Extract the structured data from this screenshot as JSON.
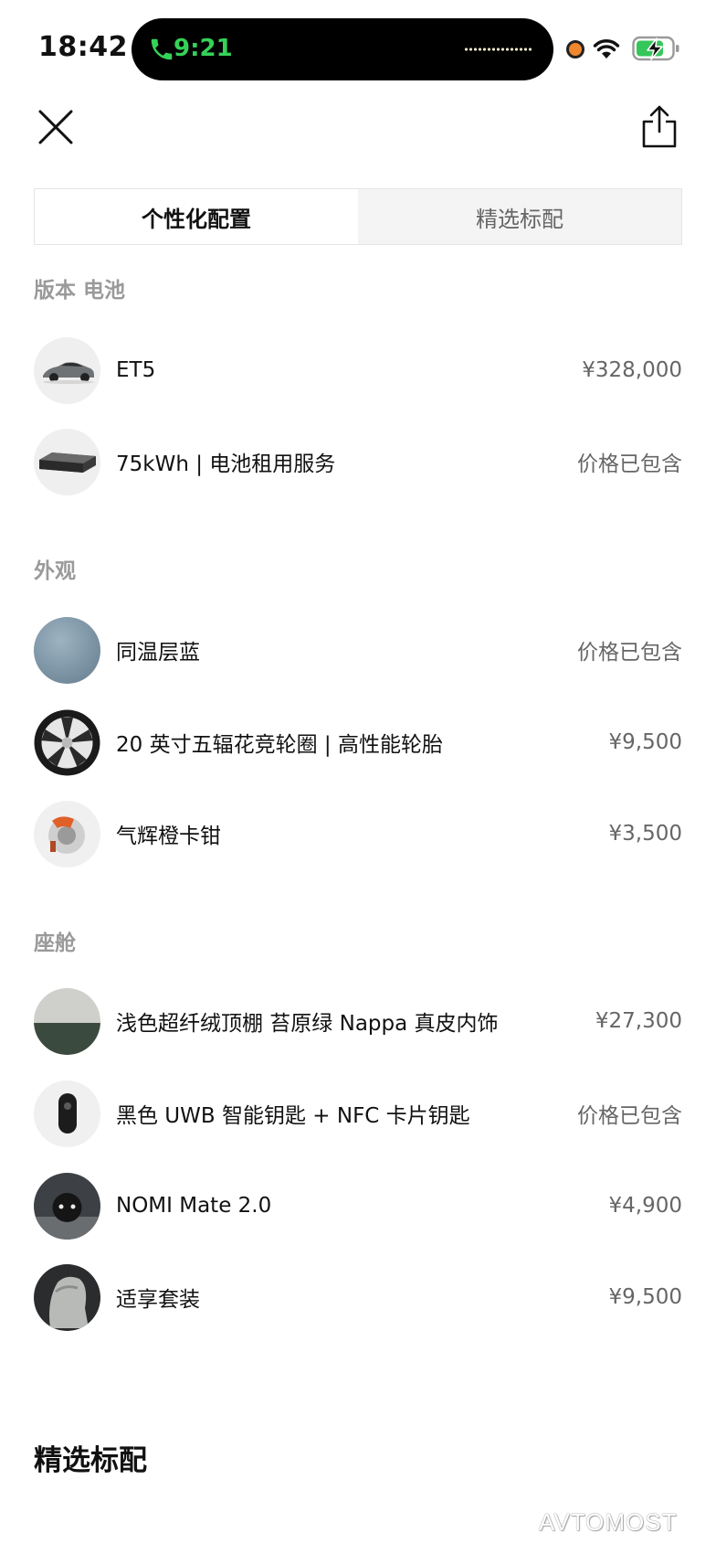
{
  "status_bar": {
    "time": "18:42",
    "call_time": "9:21"
  },
  "header": {
    "close_icon": "close-icon",
    "share_icon": "share-icon"
  },
  "tabs": [
    {
      "label": "个性化配置",
      "active": true
    },
    {
      "label": "精选标配",
      "active": false
    }
  ],
  "sections": {
    "version_battery": {
      "title": "版本 电池",
      "items": [
        {
          "label": "ET5",
          "price": "¥328,000"
        },
        {
          "label": "75kWh | 电池租用服务",
          "price": "价格已包含"
        }
      ]
    },
    "exterior": {
      "title": "外观",
      "items": [
        {
          "label": "同温层蓝",
          "price": "价格已包含"
        },
        {
          "label": "20 英寸五辐花竞轮圈 | 高性能轮胎",
          "price": "¥9,500"
        },
        {
          "label": "气辉橙卡钳",
          "price": "¥3,500"
        }
      ]
    },
    "cabin": {
      "title": "座舱",
      "items": [
        {
          "label": "浅色超纤绒顶棚 苔原绿 Nappa 真皮内饰",
          "price": "¥27,300"
        },
        {
          "label": "黑色 UWB 智能钥匙 + NFC 卡片钥匙",
          "price": "价格已包含"
        },
        {
          "label": "NOMI Mate 2.0",
          "price": "¥4,900"
        },
        {
          "label": "适享套装",
          "price": "¥9,500"
        }
      ]
    }
  },
  "footer": {
    "title": "精选标配"
  },
  "watermark": "AVTOMOST",
  "colors": {
    "call_green": "#35d158",
    "stratosphere_blue": "#8aa3b3",
    "tundra_green": "#3a4a3e",
    "caliper_orange": "#e0602a"
  }
}
